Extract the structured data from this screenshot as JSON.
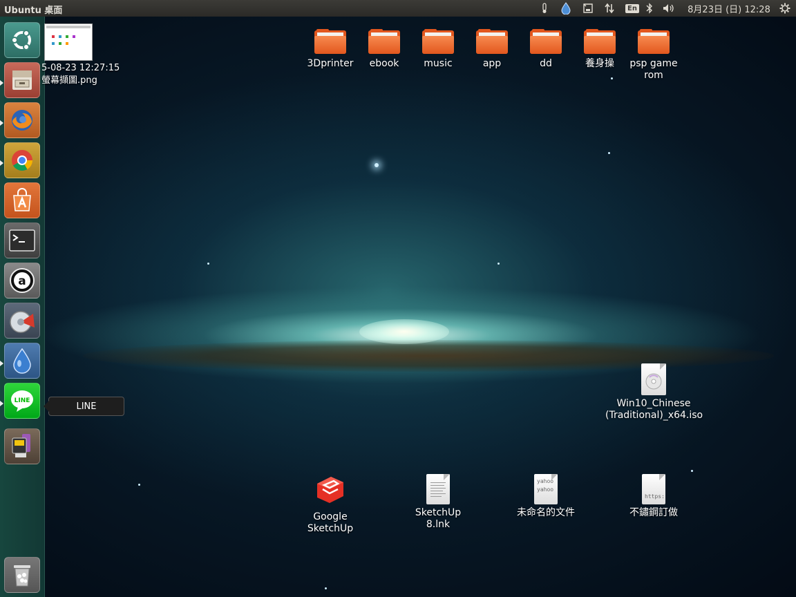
{
  "top_panel": {
    "title": "Ubuntu 桌面",
    "keyboard_layout": "En",
    "clock": "8月23日 (日) 12:28",
    "tray_icons": [
      "thermometer-icon",
      "water-drop-icon",
      "sd-card-icon",
      "network-icon",
      "keyboard-layout-icon",
      "bluetooth-icon",
      "volume-icon",
      "clock",
      "power-gear-icon"
    ]
  },
  "launcher": {
    "items": [
      {
        "name": "ubuntu-dash",
        "icon": "ubuntu-logo-icon"
      },
      {
        "name": "files",
        "icon": "file-cabinet-icon"
      },
      {
        "name": "firefox",
        "icon": "firefox-icon"
      },
      {
        "name": "chrome",
        "icon": "chrome-icon"
      },
      {
        "name": "software-center",
        "icon": "shopping-bag-icon"
      },
      {
        "name": "terminal",
        "icon": "terminal-icon"
      },
      {
        "name": "amarok",
        "icon": "a-logo-icon"
      },
      {
        "name": "app-dial",
        "icon": "dial-icon"
      },
      {
        "name": "deluge",
        "icon": "water-drop-icon"
      },
      {
        "name": "line",
        "icon": "line-chat-icon",
        "label": "LINE"
      },
      {
        "name": "sd-card-tool",
        "icon": "sd-card-icon"
      },
      {
        "name": "trash",
        "icon": "trash-icon"
      }
    ],
    "tooltip": "LINE"
  },
  "desktop": {
    "screenshot_file": {
      "line1": "5-08-23 12:27:15",
      "line2": "螢幕擷圖.png"
    },
    "folders": [
      "3Dprinter",
      "ebook",
      "music",
      "app",
      "dd",
      "養身操",
      "psp game rom"
    ],
    "iso_file": "Win10_Chinese (Traditional)_x64.iso",
    "bottom_files": [
      {
        "label": "Google SketchUp",
        "icon": "sketchup-icon"
      },
      {
        "label": "SketchUp 8.lnk",
        "icon": "text-document-icon"
      },
      {
        "label": "未命名的文件",
        "icon": "text-document-icon",
        "preview": "yahoo\nyahoo"
      },
      {
        "label": "不鏽鋼訂做",
        "icon": "text-document-icon",
        "preview": "https:"
      }
    ]
  },
  "colors": {
    "panel_bg": "#3c3b37",
    "launcher_bg": "#1f5a50",
    "folder_orange": "#e2571e",
    "line_green": "#00c300"
  }
}
